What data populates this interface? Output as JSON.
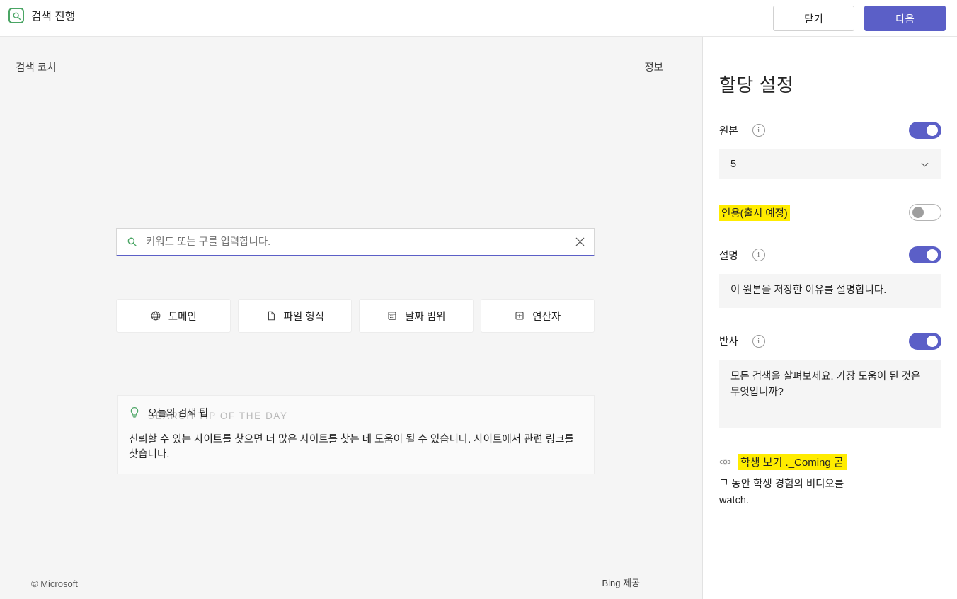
{
  "topbar": {
    "app_icon": "search-box-icon",
    "title": "검색 진행",
    "close_label": "닫기",
    "next_label": "다음",
    "accent_color": "#5b5fc7"
  },
  "main": {
    "coach_label": "검색 코치",
    "info_label": "정보",
    "search": {
      "value": "키워드 또는 구를 입력합니다.",
      "placeholder": "키워드 또는 구를 입력합니다.",
      "search_icon": "magnifier-icon",
      "clear_icon": "close-icon",
      "underline_color": "#5b5fc7"
    },
    "filters": [
      {
        "label": "도메인",
        "icon": "globe-icon"
      },
      {
        "label": "파일 형식",
        "icon": "document-icon"
      },
      {
        "label": "날짜 범위",
        "icon": "calendar-icon"
      },
      {
        "label": "연산자",
        "icon": "plus-box-icon"
      }
    ],
    "tip": {
      "icon": "lightbulb-icon",
      "title_ko": "오늘의 검색 팁",
      "title_en": "SEARCH TIP OF THE DAY",
      "body": "신뢰할 수 있는 사이트를 찾으면 더 많은 사이트를 찾는 데 도움이 될 수 있습니다. 사이트에서 관련 링크를 찾습니다."
    },
    "copyright": "© Microsoft",
    "powered_by": "Bing 제공"
  },
  "settings": {
    "title": "할당 설정",
    "sources": {
      "label": "원본",
      "info_icon": "info-icon",
      "toggle_state": "on",
      "select_value": "5",
      "chevron_icon": "chevron-down-icon"
    },
    "citations": {
      "label": "인용(출시 예정)",
      "highlighted": true,
      "highlight_color": "#ffec00",
      "toggle_state": "off"
    },
    "description": {
      "label": "설명",
      "info_icon": "info-icon",
      "toggle_state": "on",
      "field_value": "이 원본을 저장한 이유를 설명합니다."
    },
    "reflection": {
      "label": "반사",
      "info_icon": "info-icon",
      "toggle_state": "on",
      "field_value": "모든 검색을 살펴보세요. 가장 도움이 된 것은 무엇입니까?"
    },
    "student_view": {
      "icon": "eye-icon",
      "title": "학생 보기 ._Coming 곧",
      "highlight_color": "#ffec00",
      "description": "그 동안 학생 경험의 비디오를 watch."
    }
  }
}
